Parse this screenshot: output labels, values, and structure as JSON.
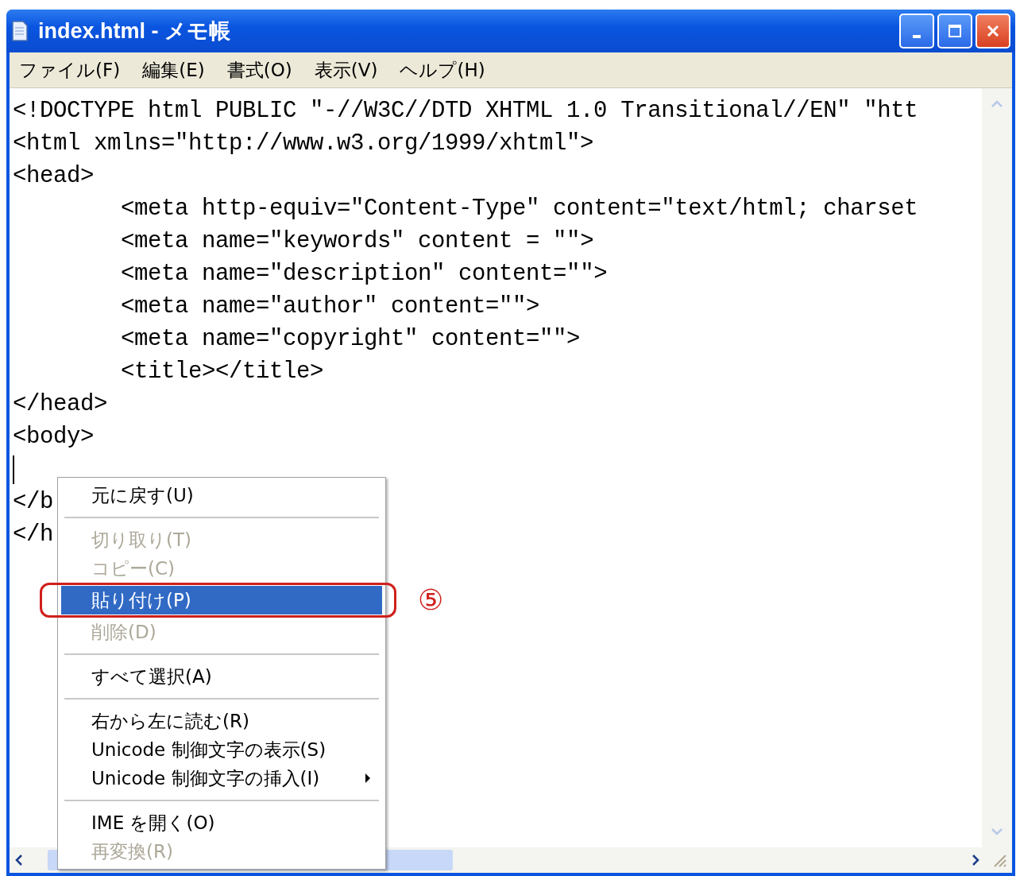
{
  "window": {
    "title": "index.html - メモ帳"
  },
  "menu_bar": [
    "ファイル(F)",
    "編集(E)",
    "書式(O)",
    "表示(V)",
    "ヘルプ(H)"
  ],
  "editor": {
    "lines": [
      {
        "text": "<!DOCTYPE html PUBLIC \"-//W3C//DTD XHTML 1.0 Transitional//EN\" \"htt",
        "caret": false
      },
      {
        "text": "<html xmlns=\"http://www.w3.org/1999/xhtml\">",
        "caret": false
      },
      {
        "text": "<head>",
        "caret": false
      },
      {
        "text": "\t<meta http-equiv=\"Content-Type\" content=\"text/html; charset",
        "caret": false
      },
      {
        "text": "\t<meta name=\"keywords\" content = \"\">",
        "caret": false
      },
      {
        "text": "\t<meta name=\"description\" content=\"\">",
        "caret": false
      },
      {
        "text": "\t<meta name=\"author\" content=\"\">",
        "caret": false
      },
      {
        "text": "\t<meta name=\"copyright\" content=\"\">",
        "caret": false
      },
      {
        "text": "\t<title></title>",
        "caret": false
      },
      {
        "text": "</head>",
        "caret": false
      },
      {
        "text": "<body>",
        "caret": false
      },
      {
        "caret": true
      },
      {
        "text": "</b",
        "caret": false
      },
      {
        "text": "</h",
        "caret": false
      }
    ]
  },
  "context_menu": {
    "items": [
      {
        "kind": "item",
        "label": "元に戻す(U)",
        "disabled": false,
        "selected": false
      },
      {
        "kind": "separator"
      },
      {
        "kind": "item",
        "label": "切り取り(T)",
        "disabled": true,
        "selected": false
      },
      {
        "kind": "item",
        "label": "コピー(C)",
        "disabled": true,
        "selected": false
      },
      {
        "kind": "item",
        "label": "貼り付け(P)",
        "disabled": false,
        "selected": true
      },
      {
        "kind": "item",
        "label": "削除(D)",
        "disabled": true,
        "selected": false
      },
      {
        "kind": "separator"
      },
      {
        "kind": "item",
        "label": "すべて選択(A)",
        "disabled": false,
        "selected": false
      },
      {
        "kind": "separator"
      },
      {
        "kind": "item",
        "label": "右から左に読む(R)",
        "disabled": false,
        "selected": false
      },
      {
        "kind": "item",
        "label": "Unicode 制御文字の表示(S)",
        "disabled": false,
        "selected": false
      },
      {
        "kind": "submenu",
        "label": "Unicode 制御文字の挿入(I)",
        "disabled": false,
        "selected": false
      },
      {
        "kind": "separator"
      },
      {
        "kind": "item",
        "label": "IME を開く(O)",
        "disabled": false,
        "selected": false
      },
      {
        "kind": "item",
        "label": "再変換(R)",
        "disabled": true,
        "selected": false
      }
    ]
  },
  "callout": {
    "label": "⑤"
  }
}
